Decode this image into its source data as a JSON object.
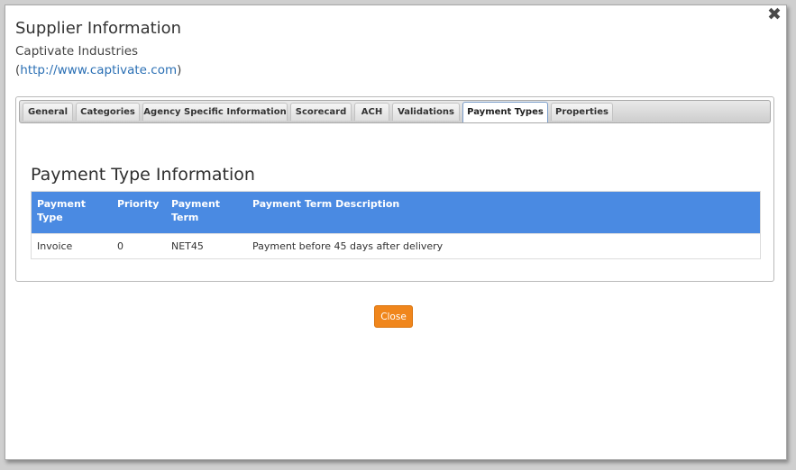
{
  "dialog": {
    "close_glyph": "✖",
    "title": "Supplier Information",
    "company": "Captivate Industries",
    "website_prefix": "(",
    "website": "http://www.captivate.com",
    "website_suffix": ")"
  },
  "tabs": [
    {
      "label": "General"
    },
    {
      "label": "Categories"
    },
    {
      "label": "Agency Specific Information"
    },
    {
      "label": "Scorecard"
    },
    {
      "label": "ACH"
    },
    {
      "label": "Validations"
    },
    {
      "label": "Payment Types",
      "active": true
    },
    {
      "label": "Properties"
    }
  ],
  "section": {
    "title": "Payment Type Information"
  },
  "table": {
    "headers": {
      "payment_type": "Payment\nType",
      "priority": "Priority",
      "payment_term": "Payment\nTerm",
      "description": "Payment Term Description"
    },
    "rows": [
      {
        "payment_type": "Invoice",
        "priority": "0",
        "payment_term": "NET45",
        "description": "Payment before 45 days after delivery"
      }
    ]
  },
  "footer": {
    "close_label": "Close"
  },
  "colors": {
    "accent": "#4a8ae2",
    "button": "#f0861c",
    "link": "#2a6fb4"
  }
}
